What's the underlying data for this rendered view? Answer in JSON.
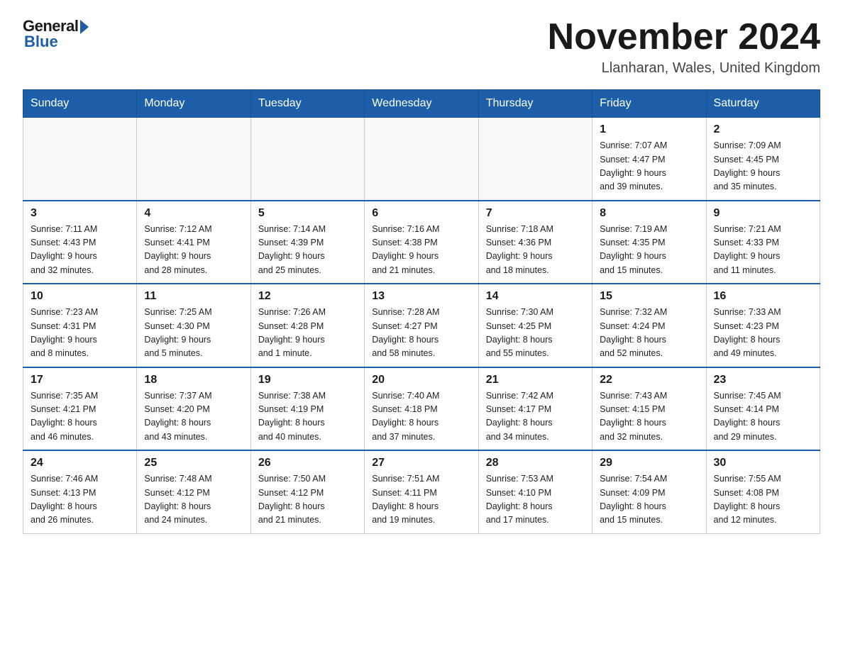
{
  "header": {
    "logo_general": "General",
    "logo_blue": "Blue",
    "month_title": "November 2024",
    "location": "Llanharan, Wales, United Kingdom"
  },
  "weekdays": [
    "Sunday",
    "Monday",
    "Tuesday",
    "Wednesday",
    "Thursday",
    "Friday",
    "Saturday"
  ],
  "weeks": [
    [
      {
        "day": "",
        "info": ""
      },
      {
        "day": "",
        "info": ""
      },
      {
        "day": "",
        "info": ""
      },
      {
        "day": "",
        "info": ""
      },
      {
        "day": "",
        "info": ""
      },
      {
        "day": "1",
        "info": "Sunrise: 7:07 AM\nSunset: 4:47 PM\nDaylight: 9 hours\nand 39 minutes."
      },
      {
        "day": "2",
        "info": "Sunrise: 7:09 AM\nSunset: 4:45 PM\nDaylight: 9 hours\nand 35 minutes."
      }
    ],
    [
      {
        "day": "3",
        "info": "Sunrise: 7:11 AM\nSunset: 4:43 PM\nDaylight: 9 hours\nand 32 minutes."
      },
      {
        "day": "4",
        "info": "Sunrise: 7:12 AM\nSunset: 4:41 PM\nDaylight: 9 hours\nand 28 minutes."
      },
      {
        "day": "5",
        "info": "Sunrise: 7:14 AM\nSunset: 4:39 PM\nDaylight: 9 hours\nand 25 minutes."
      },
      {
        "day": "6",
        "info": "Sunrise: 7:16 AM\nSunset: 4:38 PM\nDaylight: 9 hours\nand 21 minutes."
      },
      {
        "day": "7",
        "info": "Sunrise: 7:18 AM\nSunset: 4:36 PM\nDaylight: 9 hours\nand 18 minutes."
      },
      {
        "day": "8",
        "info": "Sunrise: 7:19 AM\nSunset: 4:35 PM\nDaylight: 9 hours\nand 15 minutes."
      },
      {
        "day": "9",
        "info": "Sunrise: 7:21 AM\nSunset: 4:33 PM\nDaylight: 9 hours\nand 11 minutes."
      }
    ],
    [
      {
        "day": "10",
        "info": "Sunrise: 7:23 AM\nSunset: 4:31 PM\nDaylight: 9 hours\nand 8 minutes."
      },
      {
        "day": "11",
        "info": "Sunrise: 7:25 AM\nSunset: 4:30 PM\nDaylight: 9 hours\nand 5 minutes."
      },
      {
        "day": "12",
        "info": "Sunrise: 7:26 AM\nSunset: 4:28 PM\nDaylight: 9 hours\nand 1 minute."
      },
      {
        "day": "13",
        "info": "Sunrise: 7:28 AM\nSunset: 4:27 PM\nDaylight: 8 hours\nand 58 minutes."
      },
      {
        "day": "14",
        "info": "Sunrise: 7:30 AM\nSunset: 4:25 PM\nDaylight: 8 hours\nand 55 minutes."
      },
      {
        "day": "15",
        "info": "Sunrise: 7:32 AM\nSunset: 4:24 PM\nDaylight: 8 hours\nand 52 minutes."
      },
      {
        "day": "16",
        "info": "Sunrise: 7:33 AM\nSunset: 4:23 PM\nDaylight: 8 hours\nand 49 minutes."
      }
    ],
    [
      {
        "day": "17",
        "info": "Sunrise: 7:35 AM\nSunset: 4:21 PM\nDaylight: 8 hours\nand 46 minutes."
      },
      {
        "day": "18",
        "info": "Sunrise: 7:37 AM\nSunset: 4:20 PM\nDaylight: 8 hours\nand 43 minutes."
      },
      {
        "day": "19",
        "info": "Sunrise: 7:38 AM\nSunset: 4:19 PM\nDaylight: 8 hours\nand 40 minutes."
      },
      {
        "day": "20",
        "info": "Sunrise: 7:40 AM\nSunset: 4:18 PM\nDaylight: 8 hours\nand 37 minutes."
      },
      {
        "day": "21",
        "info": "Sunrise: 7:42 AM\nSunset: 4:17 PM\nDaylight: 8 hours\nand 34 minutes."
      },
      {
        "day": "22",
        "info": "Sunrise: 7:43 AM\nSunset: 4:15 PM\nDaylight: 8 hours\nand 32 minutes."
      },
      {
        "day": "23",
        "info": "Sunrise: 7:45 AM\nSunset: 4:14 PM\nDaylight: 8 hours\nand 29 minutes."
      }
    ],
    [
      {
        "day": "24",
        "info": "Sunrise: 7:46 AM\nSunset: 4:13 PM\nDaylight: 8 hours\nand 26 minutes."
      },
      {
        "day": "25",
        "info": "Sunrise: 7:48 AM\nSunset: 4:12 PM\nDaylight: 8 hours\nand 24 minutes."
      },
      {
        "day": "26",
        "info": "Sunrise: 7:50 AM\nSunset: 4:12 PM\nDaylight: 8 hours\nand 21 minutes."
      },
      {
        "day": "27",
        "info": "Sunrise: 7:51 AM\nSunset: 4:11 PM\nDaylight: 8 hours\nand 19 minutes."
      },
      {
        "day": "28",
        "info": "Sunrise: 7:53 AM\nSunset: 4:10 PM\nDaylight: 8 hours\nand 17 minutes."
      },
      {
        "day": "29",
        "info": "Sunrise: 7:54 AM\nSunset: 4:09 PM\nDaylight: 8 hours\nand 15 minutes."
      },
      {
        "day": "30",
        "info": "Sunrise: 7:55 AM\nSunset: 4:08 PM\nDaylight: 8 hours\nand 12 minutes."
      }
    ]
  ]
}
